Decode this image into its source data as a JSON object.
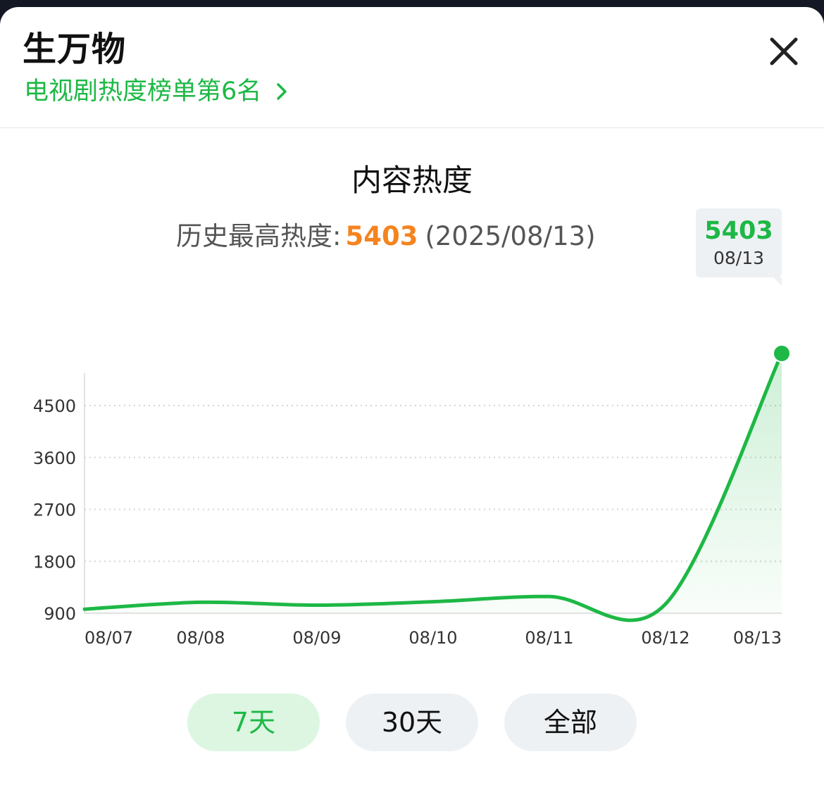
{
  "header": {
    "title": "生万物",
    "rank_link": "电视剧热度榜单第6名"
  },
  "chart_section": {
    "heading": "内容热度",
    "peak_label": "历史最高热度:",
    "peak_value": "5403",
    "peak_date": "(2025/08/13)",
    "tooltip": {
      "value": "5403",
      "date": "08/13"
    }
  },
  "range_tabs": [
    {
      "label": "7天",
      "active": true
    },
    {
      "label": "30天",
      "active": false
    },
    {
      "label": "全部",
      "active": false
    }
  ],
  "colors": {
    "accent": "#1db845",
    "peak": "#f5841f"
  },
  "chart_data": {
    "type": "area",
    "categories": [
      "08/07",
      "08/08",
      "08/09",
      "08/10",
      "08/11",
      "08/12",
      "08/13"
    ],
    "y_ticks": [
      "900",
      "1800",
      "2700",
      "3600",
      "4500"
    ],
    "ylim": [
      900,
      5403
    ],
    "grid": true,
    "series": [
      {
        "values": [
          970,
          1090,
          1040,
          1100,
          1190,
          1060,
          5403
        ]
      }
    ],
    "highlight_point": {
      "category": "08/13",
      "value": 5403
    }
  }
}
